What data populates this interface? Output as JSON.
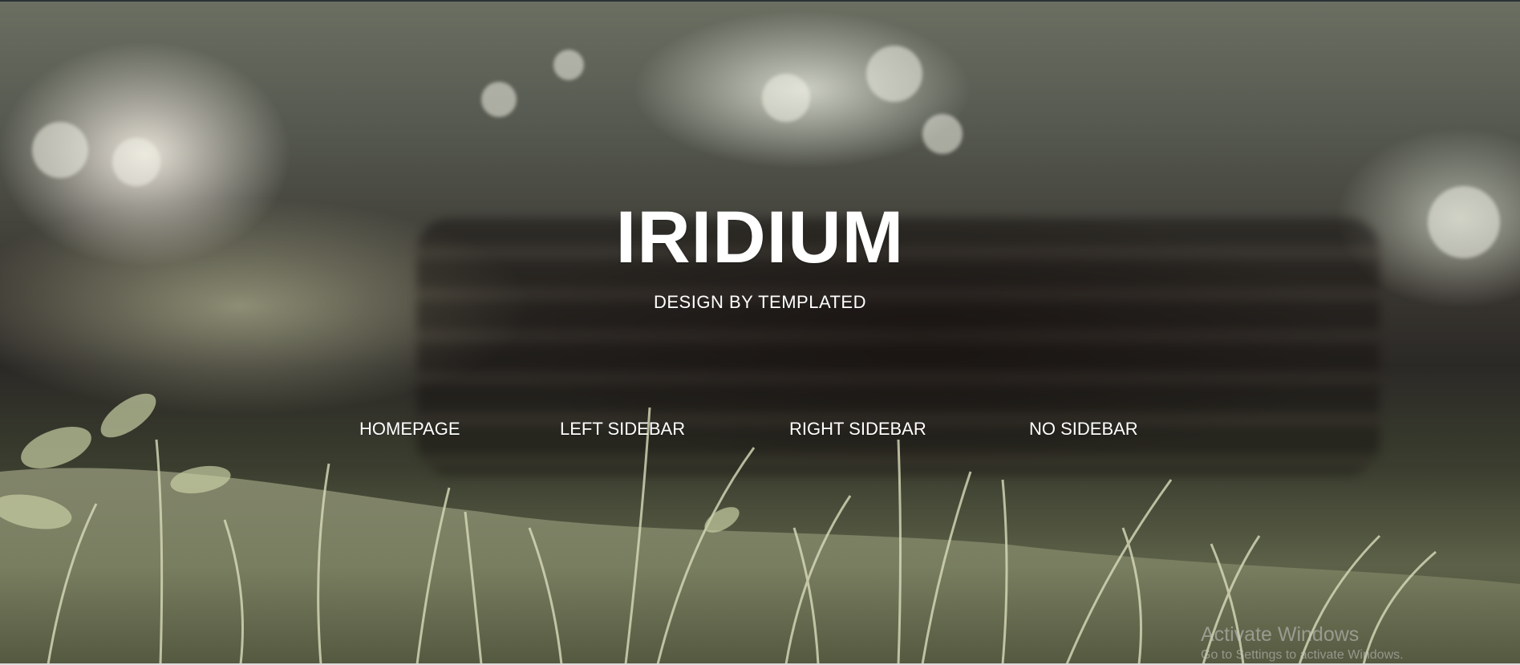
{
  "header": {
    "title": "IRIDIUM",
    "subtitle": "DESIGN BY TEMPLATED"
  },
  "nav": {
    "items": [
      {
        "label": "HOMEPAGE"
      },
      {
        "label": "LEFT SIDEBAR"
      },
      {
        "label": "RIGHT SIDEBAR"
      },
      {
        "label": "NO SIDEBAR"
      }
    ]
  },
  "os_watermark": {
    "line1": "Activate Windows",
    "line2": "Go to Settings to activate Windows."
  },
  "colors": {
    "text": "#ffffff",
    "background_photo_tint": "#3a3d2e"
  }
}
